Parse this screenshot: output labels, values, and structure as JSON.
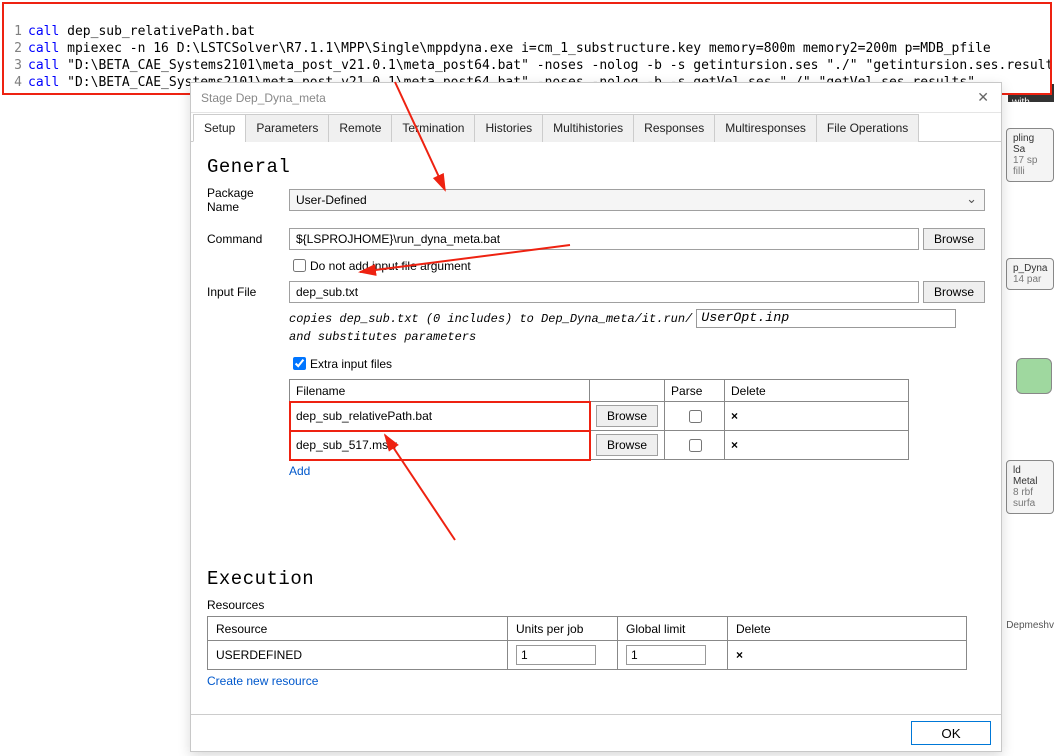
{
  "code": {
    "lines": [
      {
        "n": "1",
        "kw": "call",
        "rest": " dep_sub_relativePath.bat"
      },
      {
        "n": "2",
        "kw": "call",
        "rest": " mpiexec -n 16 D:\\LSTCSolver\\R7.1.1\\MPP\\Single\\mppdyna.exe i=cm_1_substructure.key memory=800m memory2=200m p=MDB_pfile"
      },
      {
        "n": "3",
        "kw": "call",
        "rest": " \"D:\\BETA_CAE_Systems2101\\meta_post_v21.0.1\\meta_post64.bat\" -noses -nolog -b -s getintursion.ses \"./\" \"getintursion.ses.results\""
      },
      {
        "n": "4",
        "kw": "call",
        "rest": " \"D:\\BETA_CAE_Systems2101\\meta_post_v21.0.1\\meta_post64.bat\" -noses -nolog -b -s getVel.ses \"./\" \"getVel.ses.results\""
      }
    ]
  },
  "dialog": {
    "title": "Stage Dep_Dyna_meta",
    "tabs": [
      "Setup",
      "Parameters",
      "Remote",
      "Termination",
      "Histories",
      "Multihistories",
      "Responses",
      "Multiresponses",
      "File Operations"
    ],
    "general": {
      "heading": "General",
      "pkg_label": "Package Name",
      "pkg_value": "User-Defined",
      "cmd_label": "Command",
      "cmd_value": "${LSPROJHOME}\\run_dyna_meta.bat",
      "browse": "Browse",
      "no_add_label": "Do not add input file argument",
      "input_label": "Input File",
      "input_value": "dep_sub.txt",
      "hint_pre": "copies dep_sub.txt (0 includes) to Dep_Dyna_meta/it.run/",
      "hint_box": "UserOpt.inp",
      "hint_post": "and substitutes parameters",
      "extra_label": "Extra input files",
      "th_filename": "Filename",
      "th_parse": "Parse",
      "th_delete": "Delete",
      "rows": [
        {
          "name": "dep_sub_relativePath.bat"
        },
        {
          "name": "dep_sub_517.msw"
        }
      ],
      "add": "Add"
    },
    "execution": {
      "heading": "Execution",
      "sub": "Resources",
      "th_resource": "Resource",
      "th_units": "Units per job",
      "th_global": "Global limit",
      "th_delete": "Delete",
      "row_name": "USERDEFINED",
      "row_units": "1",
      "row_global": "1",
      "create": "Create new resource"
    },
    "ok": "OK"
  },
  "bg": {
    "strip": "ential with",
    "node1": "pling Sa",
    "node1b": "17 sp filli",
    "node2": "p_Dyna",
    "node2b": "14 par",
    "node3": "ld Metal",
    "node3b": "8 rbf surfa",
    "depmesh": "Depmeshv"
  }
}
